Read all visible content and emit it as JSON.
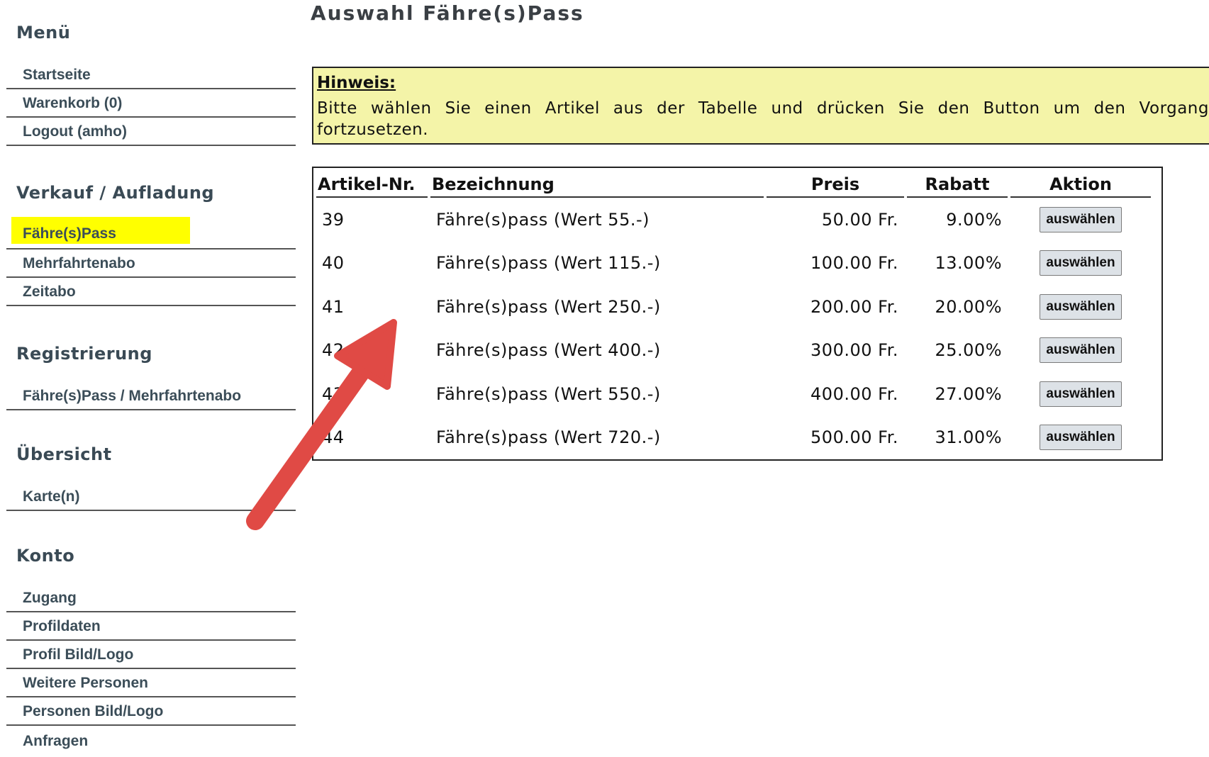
{
  "sidebar": {
    "menu_title": "Menü",
    "menu_items": [
      {
        "label": "Startseite"
      },
      {
        "label": "Warenkorb (0)"
      },
      {
        "label": "Logout (amho)"
      }
    ],
    "sale_title": "Verkauf / Aufladung",
    "sale_items": [
      {
        "label": "Fähre(s)Pass",
        "active": true
      },
      {
        "label": "Mehrfahrtenabo"
      },
      {
        "label": "Zeitabo"
      }
    ],
    "reg_title": "Registrierung",
    "reg_items": [
      {
        "label": "Fähre(s)Pass / Mehrfahrtenabo"
      }
    ],
    "overview_title": "Übersicht",
    "overview_items": [
      {
        "label": "Karte(n)"
      }
    ],
    "account_title": "Konto",
    "account_items": [
      {
        "label": "Zugang"
      },
      {
        "label": "Profildaten"
      },
      {
        "label": "Profil Bild/Logo"
      },
      {
        "label": "Weitere Personen"
      },
      {
        "label": "Personen Bild/Logo"
      },
      {
        "label": "Anfragen"
      }
    ]
  },
  "main": {
    "title": "Auswahl Fähre(s)Pass",
    "hint_title": "Hinweis:",
    "hint_text": "Bitte wählen Sie einen Artikel aus der Tabelle und drücken Sie den Button um den Vorgang fortzusetzen.",
    "table": {
      "headers": [
        "Artikel-Nr.",
        "Bezeichnung",
        "Preis",
        "Rabatt",
        "Aktion"
      ],
      "rows": [
        {
          "nr": "39",
          "name": "Fähre(s)pass (Wert 55.-)",
          "price": "50.00 Fr.",
          "discount": "9.00%",
          "action": "auswählen"
        },
        {
          "nr": "40",
          "name": "Fähre(s)pass (Wert 115.-)",
          "price": "100.00 Fr.",
          "discount": "13.00%",
          "action": "auswählen"
        },
        {
          "nr": "41",
          "name": "Fähre(s)pass (Wert 250.-)",
          "price": "200.00 Fr.",
          "discount": "20.00%",
          "action": "auswählen"
        },
        {
          "nr": "42",
          "name": "Fähre(s)pass (Wert 400.-)",
          "price": "300.00 Fr.",
          "discount": "25.00%",
          "action": "auswählen"
        },
        {
          "nr": "43",
          "name": "Fähre(s)pass (Wert 550.-)",
          "price": "400.00 Fr.",
          "discount": "27.00%",
          "action": "auswählen"
        },
        {
          "nr": "44",
          "name": "Fähre(s)pass (Wert 720.-)",
          "price": "500.00 Fr.",
          "discount": "31.00%",
          "action": "auswählen"
        }
      ]
    }
  },
  "colors": {
    "active_highlight": "#ffff00",
    "hint_background": "#f4f4a8",
    "annotation_arrow": "#e04a45"
  }
}
